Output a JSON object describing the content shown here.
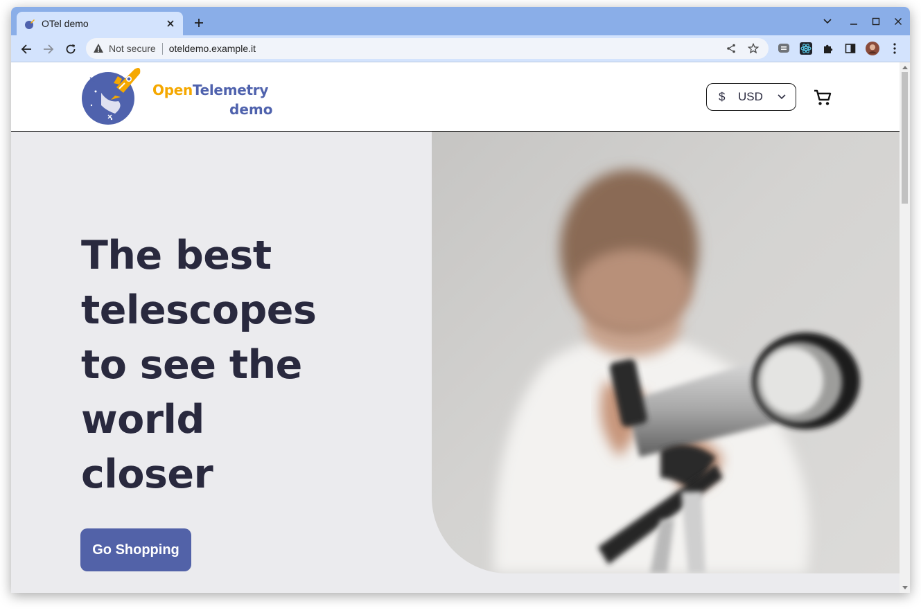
{
  "browser": {
    "tab_title": "OTel demo",
    "omnibox_security": "Not secure",
    "omnibox_url": "oteldemo.example.it"
  },
  "site": {
    "logo_word_1": "Open",
    "logo_word_2": "Telemetry",
    "logo_word_3": "demo",
    "currency_symbol": "$",
    "currency_code": "USD"
  },
  "hero": {
    "title_lines": [
      "The best",
      "telescopes",
      "to see the",
      "world",
      "closer"
    ],
    "cta_label": "Go Shopping"
  },
  "colors": {
    "brand_orange": "#f5a800",
    "brand_blue": "#4f62ad",
    "cta_bg": "#5262a8",
    "hero_text": "#29293e",
    "hero_bg": "#ebebee"
  }
}
